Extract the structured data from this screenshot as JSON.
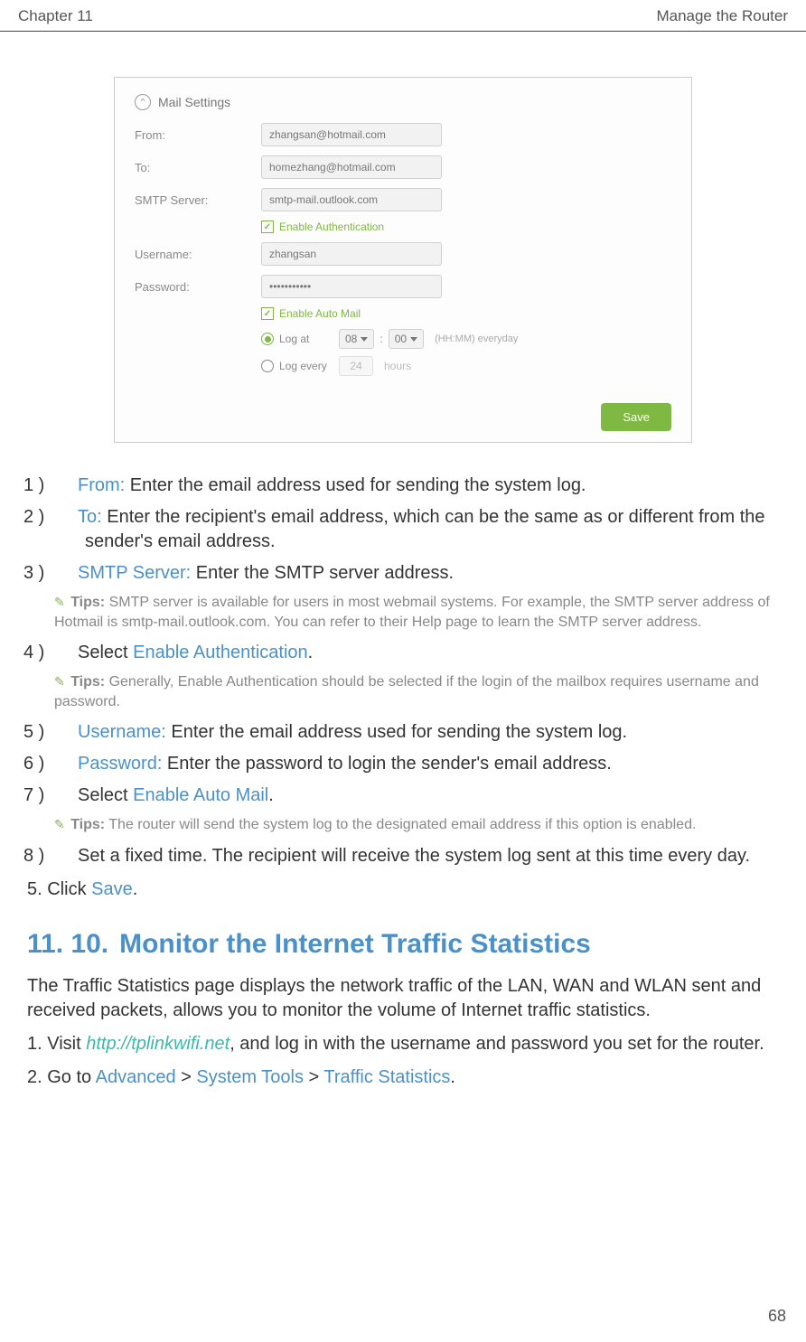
{
  "header": {
    "left": "Chapter 11",
    "right": "Manage the Router"
  },
  "screenshot": {
    "title": "Mail Settings",
    "labels": {
      "from": "From:",
      "to": "To:",
      "smtp": "SMTP Server:",
      "username": "Username:",
      "password": "Password:"
    },
    "values": {
      "from": "zhangsan@hotmail.com",
      "to": "homezhang@hotmail.com",
      "smtp": "smtp-mail.outlook.com",
      "username": "zhangsan",
      "password": "•••••••••••"
    },
    "enable_auth": "Enable Authentication",
    "enable_auto": "Enable Auto Mail",
    "log_at": "Log at",
    "hh": "08",
    "mm": "00",
    "time_suffix": "(HH:MM) everyday",
    "log_every": "Log every",
    "log_every_val": "24",
    "hours": "hours",
    "save": "Save"
  },
  "steps": {
    "s1_num": "1 )",
    "s1_label": "From:",
    "s1_text": " Enter the email address used for sending the system log.",
    "s2_num": "2 )",
    "s2_label": "To:",
    "s2_text": " Enter the recipient's email address, which can be the same as or different from the sender's email address.",
    "s3_num": "3 )",
    "s3_label": "SMTP Server:",
    "s3_text": " Enter the SMTP server address.",
    "tip1_label": "Tips:",
    "tip1_text": " SMTP server is available for users in most webmail systems. For example, the SMTP server address of Hotmail is smtp-mail.outlook.com. You can refer to their Help page to learn the SMTP server address.",
    "s4_num": "4 )",
    "s4_pre": "Select ",
    "s4_label": "Enable Authentication",
    "s4_post": ".",
    "tip2_label": "Tips:",
    "tip2_text": " Generally, Enable Authentication should be selected if the login of the mailbox requires username and password.",
    "s5_num": "5 )",
    "s5_label": "Username:",
    "s5_text": " Enter the email address used for sending the system log.",
    "s6_num": "6 )",
    "s6_label": "Password:",
    "s6_text": " Enter the password to login the sender's email address.",
    "s7_num": "7 )",
    "s7_pre": "Select ",
    "s7_label": "Enable Auto Mail",
    "s7_post": ".",
    "tip3_label": "Tips:",
    "tip3_text": " The router will send the system log to the designated email address if this option is enabled.",
    "s8_num": "8 )",
    "s8_text": "Set a fixed time. The recipient will receive the system log sent at this time every day."
  },
  "outer5_pre": "5. Click ",
  "outer5_label": "Save",
  "outer5_post": ".",
  "section": {
    "num": "11. 10.",
    "title": "Monitor the Internet Traffic Statistics"
  },
  "para": "The Traffic Statistics page displays the network traffic of the LAN, WAN and WLAN sent and received packets, allows you to monitor the volume of Internet traffic statistics.",
  "ostep1_pre": "1. Visit ",
  "ostep1_link": "http://tplinkwifi.net",
  "ostep1_post": ", and log in with the username and password you set for the router.",
  "ostep2_pre": "2. Go to ",
  "ostep2_a": "Advanced",
  "ostep2_sep1": " > ",
  "ostep2_b": "System Tools",
  "ostep2_sep2": " > ",
  "ostep2_c": "Traffic Statistics",
  "ostep2_post": ".",
  "page_num": "68"
}
